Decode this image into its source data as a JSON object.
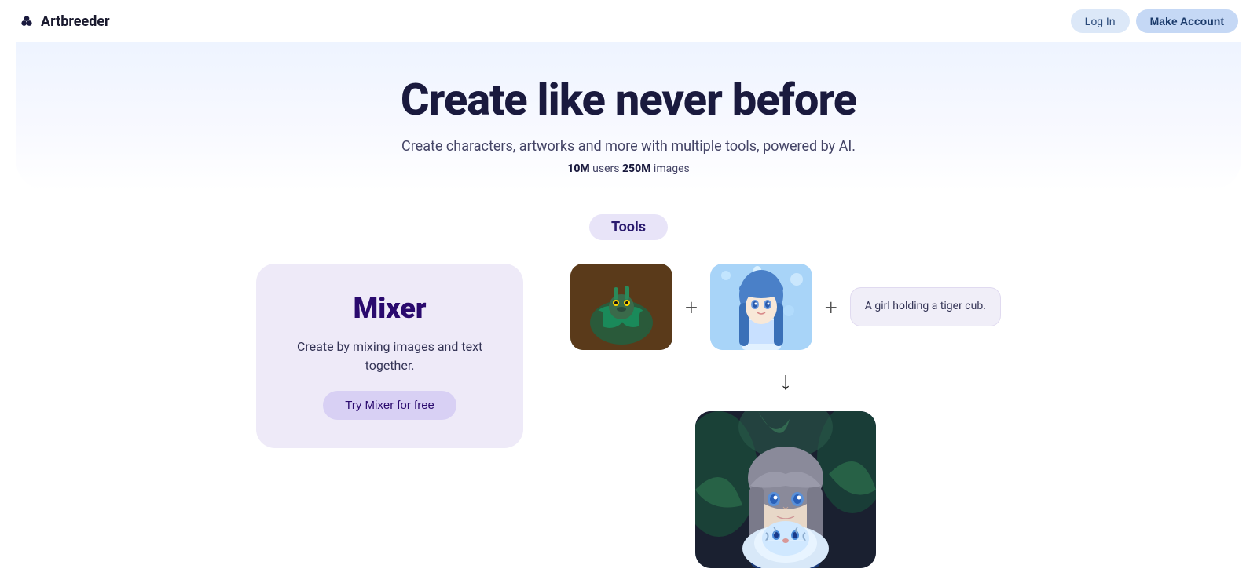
{
  "header": {
    "logo_text": "Artbreeder",
    "login_label": "Log In",
    "make_account_label": "Make Account"
  },
  "hero": {
    "title": "Create like never before",
    "subtitle": "Create characters, artworks and more with multiple tools, powered by AI.",
    "stat_users_bold": "10M",
    "stat_users": " users ",
    "stat_images_bold": "250M",
    "stat_images": " images"
  },
  "tools": {
    "badge": "Tools",
    "mixer": {
      "title": "Mixer",
      "description": "Create by mixing images and text together.",
      "try_button": "Try Mixer for free"
    },
    "prompt_text": "A girl holding a tiger cub.",
    "arrow": "↓"
  },
  "colors": {
    "accent_purple": "#2a0a6e",
    "light_purple_bg": "#eeeaf8",
    "button_bg": "#d8d0f4",
    "header_bg": "#eef4ff"
  }
}
